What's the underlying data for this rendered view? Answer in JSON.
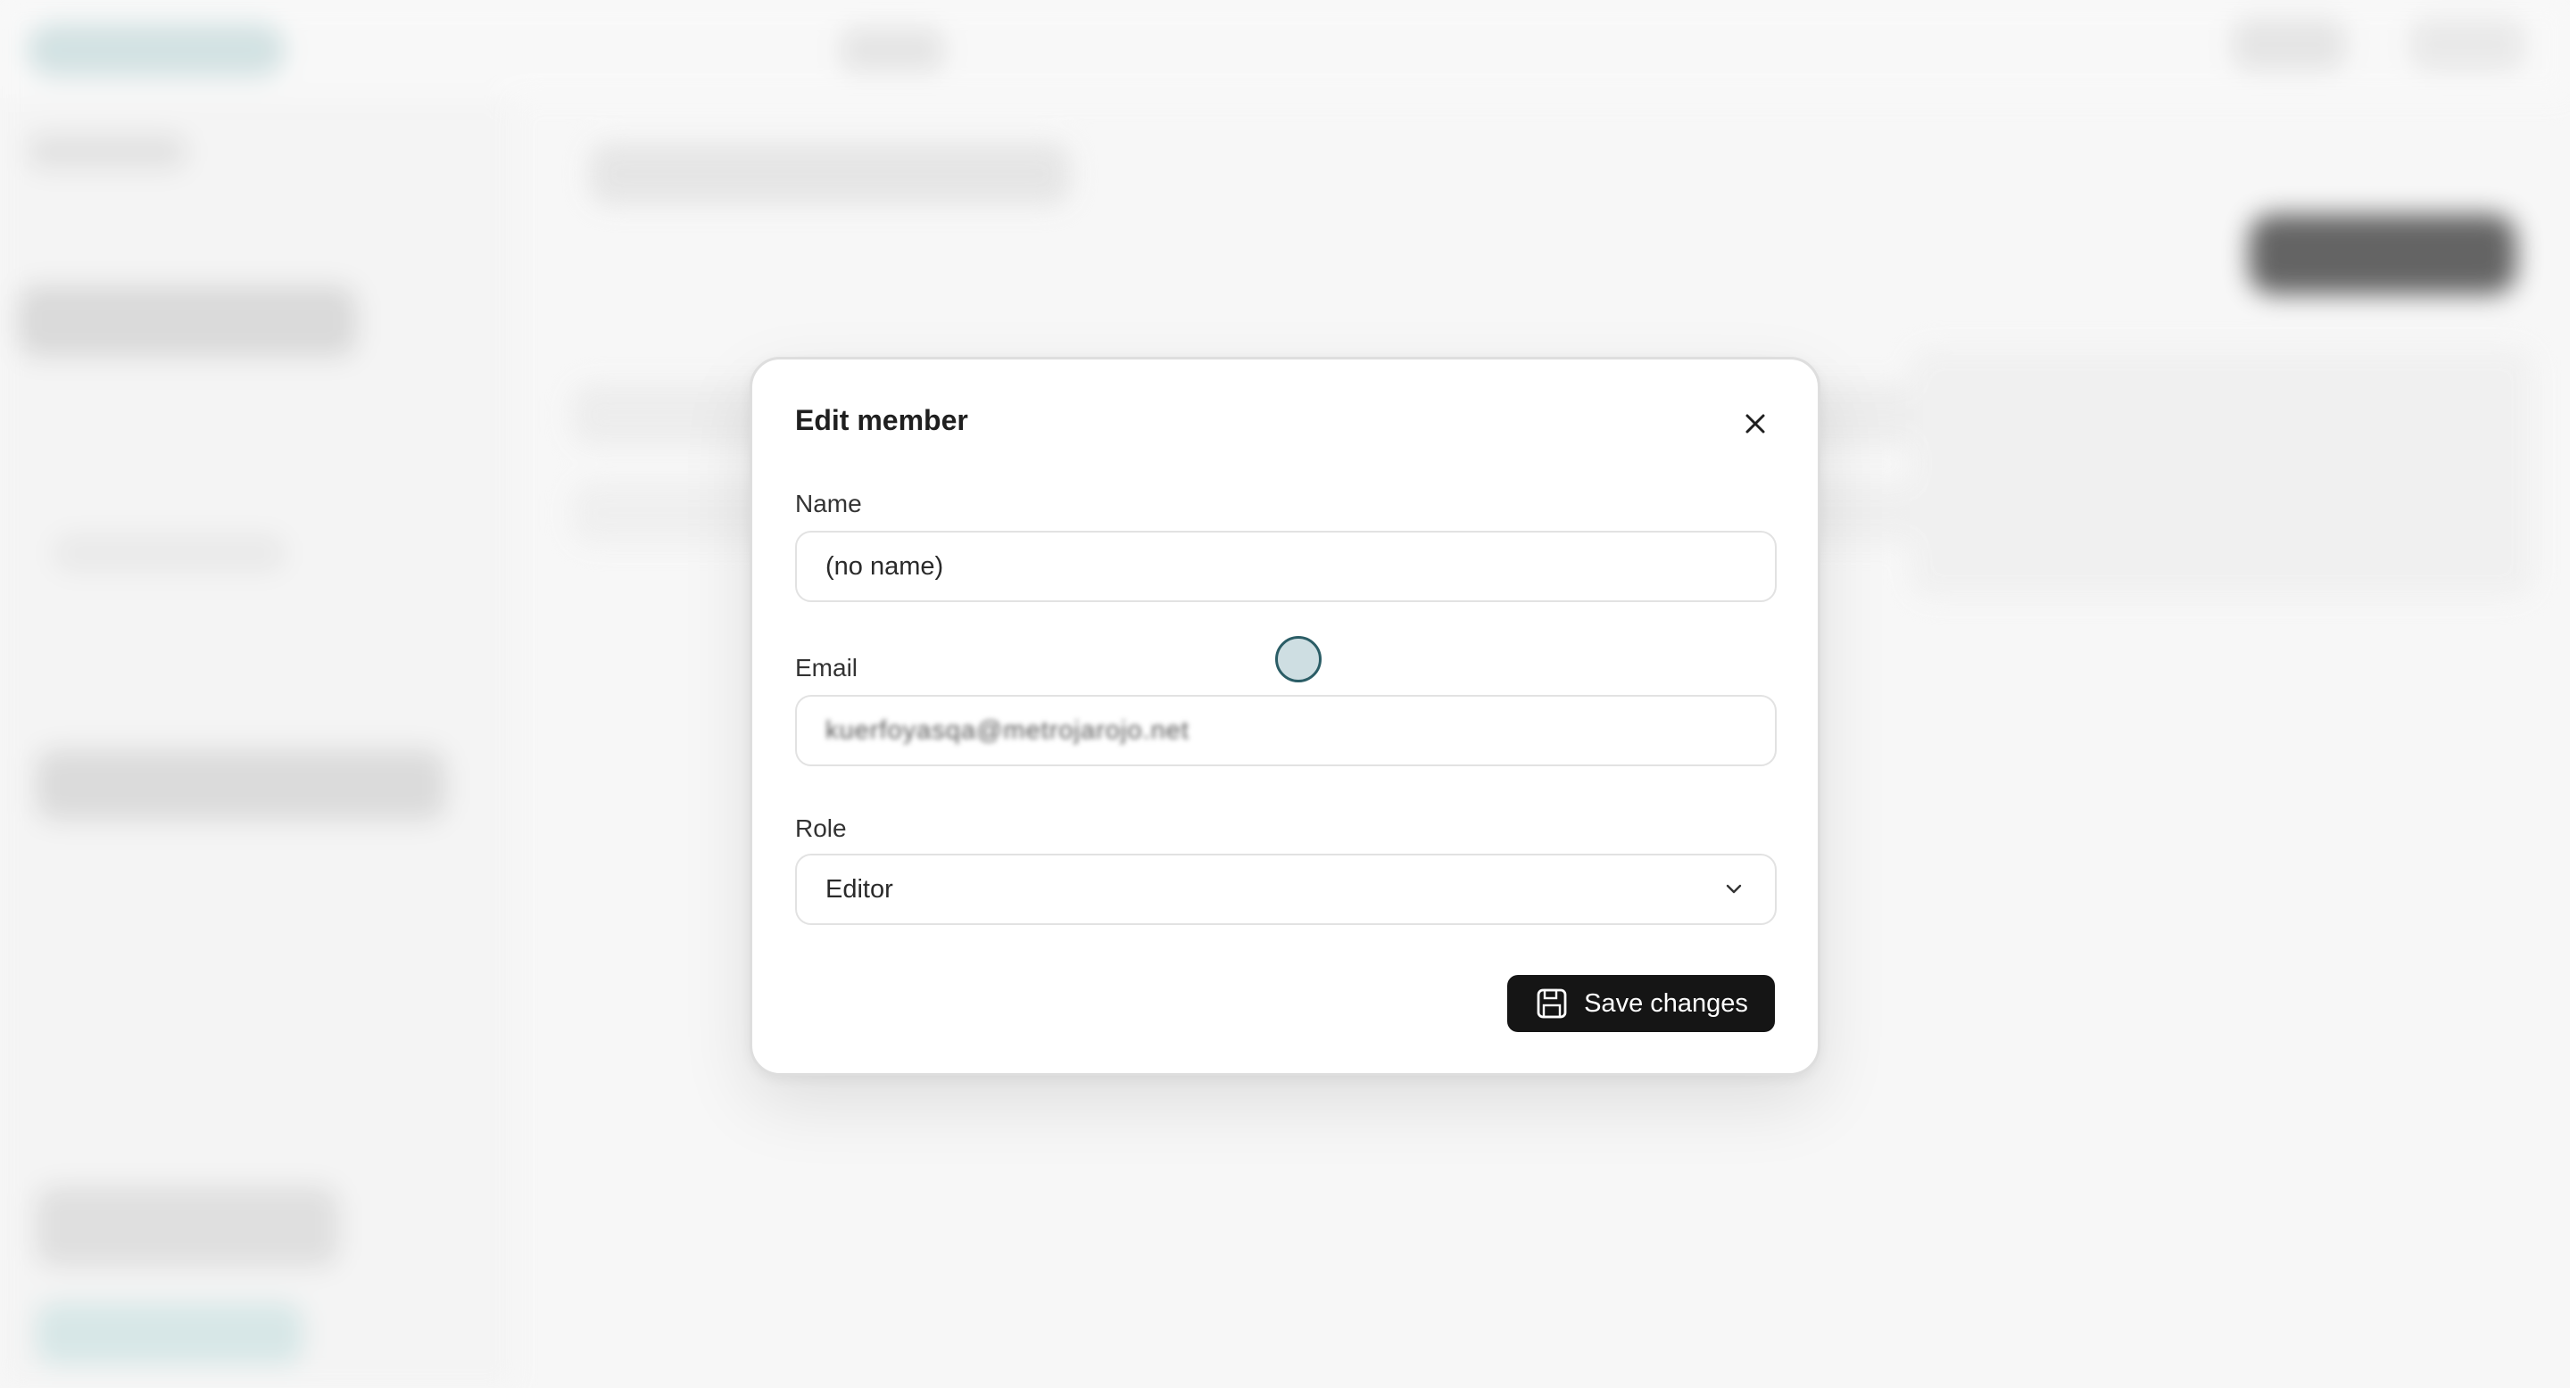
{
  "dialog": {
    "title": "Edit member",
    "fields": {
      "name": {
        "label": "Name",
        "value": "(no name)"
      },
      "email": {
        "label": "Email",
        "value": "kuerfoyasqa@metrojarojo.net"
      },
      "role": {
        "label": "Role",
        "value": "Editor"
      }
    },
    "save_label": "Save changes",
    "icons": {
      "close": "close-icon",
      "role_dropdown": "chevron-down-icon",
      "save": "floppy-disk-icon"
    }
  },
  "colors": {
    "button_bg": "#151515",
    "button_text": "#ffffff",
    "border": "#e2e2e2",
    "cursor_ring": "#2b5d66"
  }
}
